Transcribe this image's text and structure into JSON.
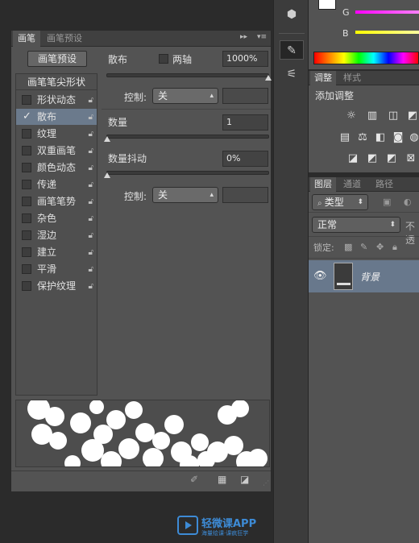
{
  "brush_panel": {
    "tabs": [
      "画笔",
      "画笔预设"
    ],
    "preset_button": "画笔预设",
    "list_header": "画笔笔尖形状",
    "items": [
      {
        "label": "形状动态",
        "checked": false
      },
      {
        "label": "散布",
        "checked": true,
        "selected": true
      },
      {
        "label": "纹理",
        "checked": false
      },
      {
        "label": "双重画笔",
        "checked": false
      },
      {
        "label": "颜色动态",
        "checked": false
      },
      {
        "label": "传递",
        "checked": false
      },
      {
        "label": "画笔笔势",
        "checked": false
      },
      {
        "label": "杂色",
        "checked": false
      },
      {
        "label": "湿边",
        "checked": false
      },
      {
        "label": "建立",
        "checked": false
      },
      {
        "label": "平滑",
        "checked": false
      },
      {
        "label": "保护纹理",
        "checked": false
      }
    ],
    "scatter": {
      "label": "散布",
      "both_axes_label": "两轴",
      "both_axes_checked": false,
      "value": "1000%",
      "slider_fraction": 1.0,
      "control_label": "控制:",
      "control_value": "关"
    },
    "count": {
      "label": "数量",
      "value": "1",
      "slider_fraction": 0.0
    },
    "count_jitter": {
      "label": "数量抖动",
      "value": "0%",
      "slider_fraction": 0.0,
      "control_label": "控制:",
      "control_value": "关"
    }
  },
  "color_panel": {
    "g_label": "G",
    "b_label": "B",
    "g_color": "#ff00ff",
    "b_color": "#ffff00"
  },
  "adjust_panel": {
    "tabs": [
      "调整",
      "样式"
    ],
    "title": "添加调整"
  },
  "layers_panel": {
    "tabs": [
      "图层",
      "通道",
      "路径"
    ],
    "filter_kind": "类型",
    "blend_mode": "正常",
    "opacity_label": "不透",
    "lock_label": "锁定:",
    "layer_name": "背景"
  },
  "watermark": {
    "brand": "轻微课APP",
    "slogan": "海量绘课·课疯狂学"
  }
}
